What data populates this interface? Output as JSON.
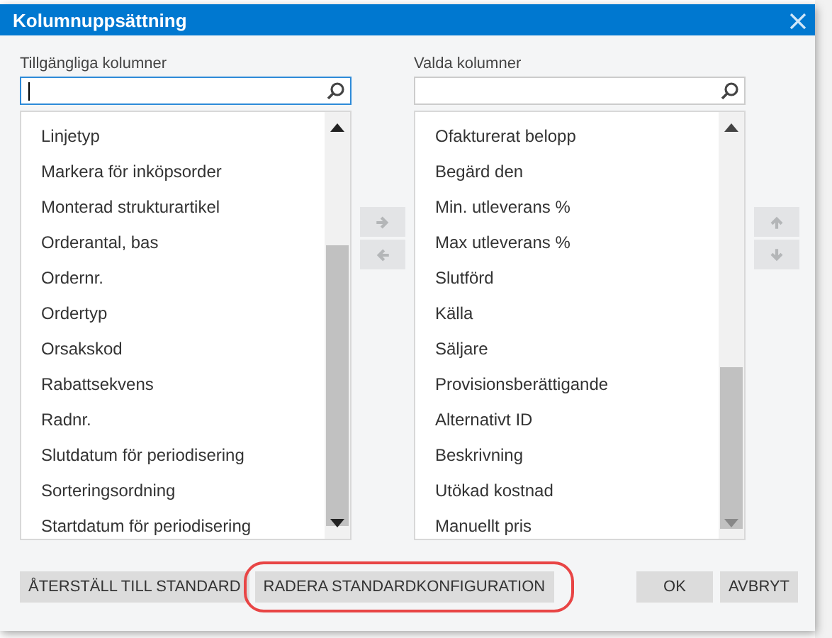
{
  "dialog": {
    "title": "Kolumnuppsättning"
  },
  "available": {
    "label": "Tillgängliga kolumner",
    "search": {
      "focused": true
    },
    "items": [
      "Linjetyp",
      "Markera för inköpsorder",
      "Monterad strukturartikel",
      "Orderantal, bas",
      "Ordernr.",
      "Ordertyp",
      "Orsakskod",
      "Rabattsekvens",
      "Radnr.",
      "Slutdatum för periodisering",
      "Sorteringsordning",
      "Startdatum för periodisering"
    ]
  },
  "transfer_buttons": [
    {
      "kind": "right",
      "disabled": true
    },
    {
      "kind": "left",
      "disabled": true
    }
  ],
  "selected_columns": {
    "label": "Valda kolumner",
    "search": {
      "focused": false
    },
    "items": [
      "Ofakturerat belopp",
      "Begärd den",
      "Min. utleverans %",
      "Max utleverans %",
      "Slutförd",
      "Källa",
      "Säljare",
      "Provisionsberättigande",
      "Alternativt ID",
      "Beskrivning",
      "Utökad kostnad",
      "Manuellt pris"
    ]
  },
  "order_buttons": [
    {
      "kind": "up",
      "disabled": true
    },
    {
      "kind": "down",
      "disabled": true
    }
  ],
  "footer_buttons": [
    {
      "label": "ÅTERSTÄLL TILL STANDARD",
      "highlighted": false
    },
    {
      "label": "RADERA STANDARDKONFIGURATION",
      "highlighted": true
    }
  ],
  "actions": [
    "OK",
    "AVBRYT"
  ]
}
